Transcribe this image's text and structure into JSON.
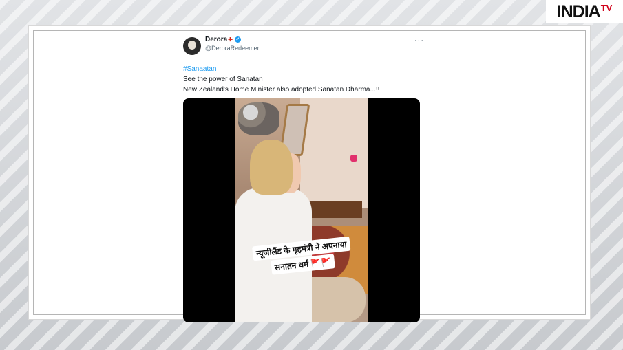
{
  "brand": {
    "logo_text": "INDIA",
    "logo_suffix": "TV"
  },
  "tweet": {
    "display_name": "Derora",
    "handle": "@DeroraRedeemer",
    "more_label": "···",
    "hashtag": "#Sanaatan",
    "line1": "See the power of Sanatan",
    "line2": "New Zealand's Home Minister also adopted Sanatan Dharma...!!",
    "media": {
      "caption_line1": "न्यूजीलैंड के गृहमंत्री ने अपनाया",
      "caption_line2": "सनातन धर्म 🚩🚩"
    }
  },
  "icons": {
    "flag": "canada-flag-icon",
    "verified": "verified-badge-icon",
    "more": "more-options-icon"
  },
  "colors": {
    "link": "#1d9bf0",
    "brand_red": "#d0021b"
  }
}
